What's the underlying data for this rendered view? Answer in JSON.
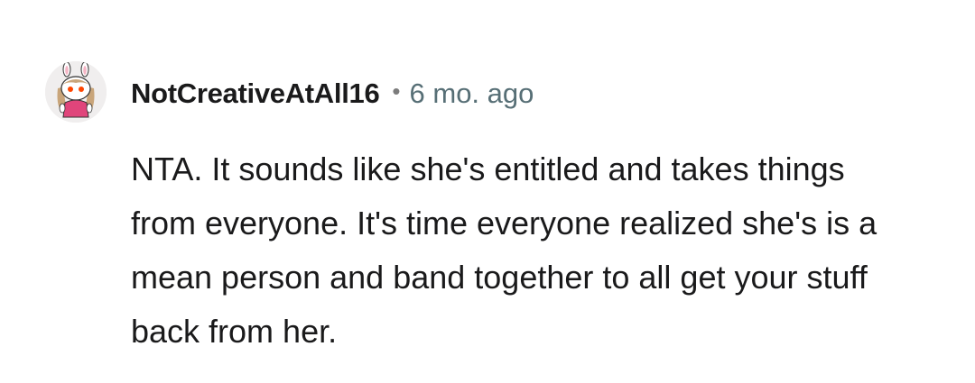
{
  "comment": {
    "author": "NotCreativeAtAll16",
    "separator": "•",
    "timestamp": "6 mo. ago",
    "avatar_icon": "snoo-avatar-icon",
    "body": "NTA. It sounds like she's entitled and takes things from everyone. It's time everyone realized she's is a mean person and band together to all get your stuff back from her."
  },
  "colors": {
    "background": "#ffffff",
    "text": "#1a1a1b",
    "meta": "#576f76",
    "avatar_shirt": "#e0457b",
    "avatar_eye": "#ff4500"
  }
}
